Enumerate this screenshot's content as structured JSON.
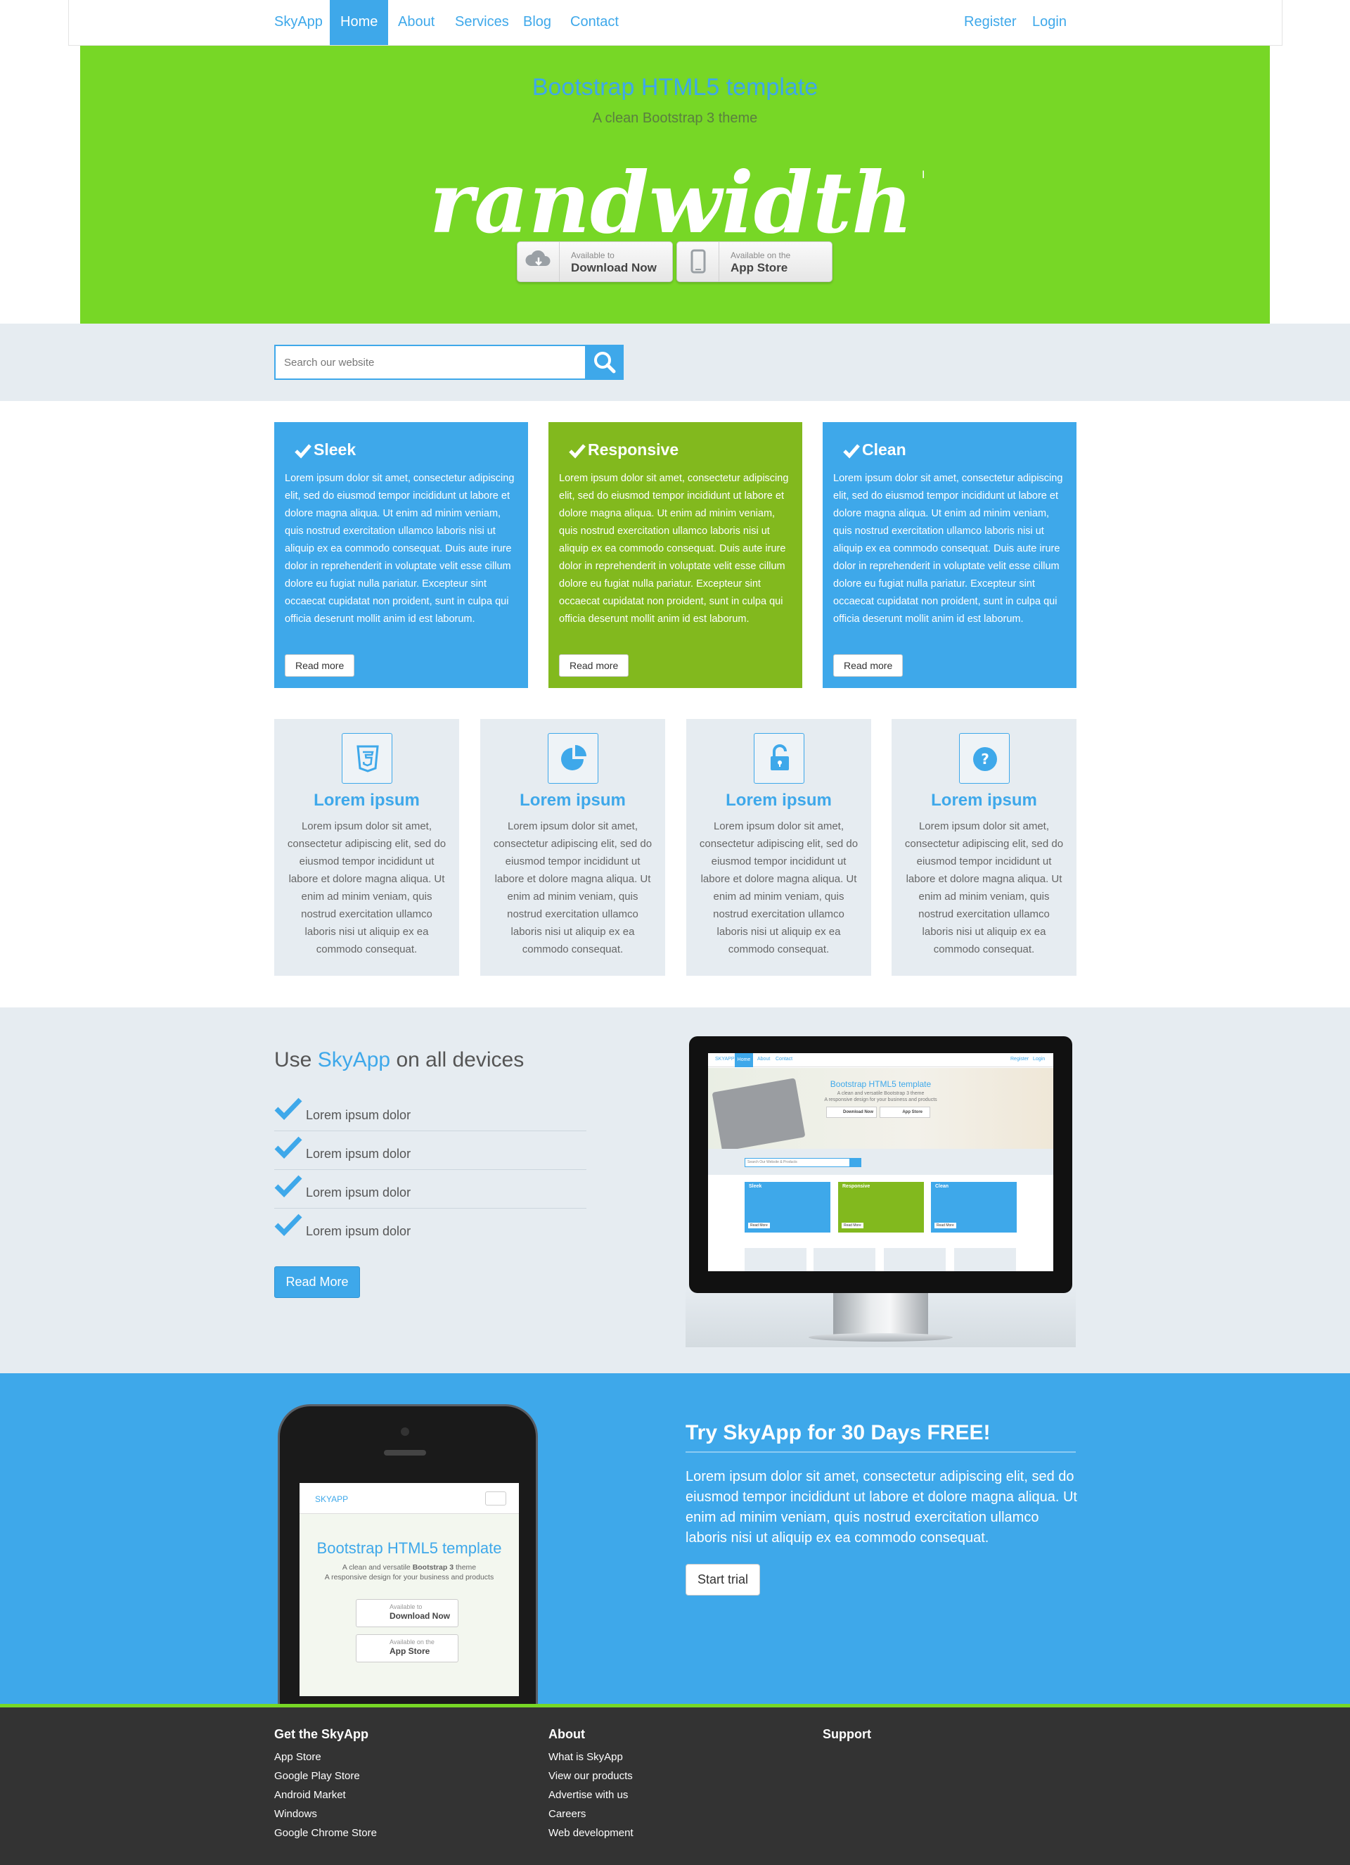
{
  "nav": {
    "brand": "SkyApp",
    "links": [
      "Home",
      "About",
      "Services",
      "Blog",
      "Contact"
    ],
    "active": "Home",
    "right": [
      "Register",
      "Login"
    ]
  },
  "hero": {
    "title": "Bootstrap HTML5 template",
    "subtitle": "A clean Bootstrap 3 theme",
    "logo_text": "Brandwidth™",
    "buttons": [
      {
        "small": "Available to",
        "big": "Download Now",
        "icon": "download-cloud-icon"
      },
      {
        "small": "Available on the",
        "big": "App Store",
        "icon": "phone-icon"
      }
    ]
  },
  "search": {
    "placeholder": "Search our website",
    "icon": "search-icon"
  },
  "features": [
    {
      "title": "Sleek",
      "color": "#3ea8ea",
      "text": "Lorem ipsum dolor sit amet, consectetur adipiscing elit, sed do eiusmod tempor incididunt ut labore et dolore magna aliqua. Ut enim ad minim veniam, quis nostrud exercitation ullamco laboris nisi ut aliquip ex ea commodo consequat. Duis aute irure dolor in reprehenderit in voluptate velit esse cillum dolore eu fugiat nulla pariatur. Excepteur sint occaecat cupidatat non proident, sunt in culpa qui officia deserunt mollit anim id est laborum.",
      "button": "Read more"
    },
    {
      "title": "Responsive",
      "color": "#82b91e",
      "text": "Lorem ipsum dolor sit amet, consectetur adipiscing elit, sed do eiusmod tempor incididunt ut labore et dolore magna aliqua. Ut enim ad minim veniam, quis nostrud exercitation ullamco laboris nisi ut aliquip ex ea commodo consequat. Duis aute irure dolor in reprehenderit in voluptate velit esse cillum dolore eu fugiat nulla pariatur. Excepteur sint occaecat cupidatat non proident, sunt in culpa qui officia deserunt mollit anim id est laborum.",
      "button": "Read more"
    },
    {
      "title": "Clean",
      "color": "#3ea8ea",
      "text": "Lorem ipsum dolor sit amet, consectetur adipiscing elit, sed do eiusmod tempor incididunt ut labore et dolore magna aliqua. Ut enim ad minim veniam, quis nostrud exercitation ullamco laboris nisi ut aliquip ex ea commodo consequat. Duis aute irure dolor in reprehenderit in voluptate velit esse cillum dolore eu fugiat nulla pariatur. Excepteur sint occaecat cupidatat non proident, sunt in culpa qui officia deserunt mollit anim id est laborum.",
      "button": "Read more"
    }
  ],
  "cards": [
    {
      "icon": "html5-icon",
      "title": "Lorem ipsum",
      "text": "Lorem ipsum dolor sit amet, consectetur adipiscing elit, sed do eiusmod tempor incididunt ut labore et dolore magna aliqua. Ut enim ad minim veniam, quis nostrud exercitation ullamco laboris nisi ut aliquip ex ea commodo consequat."
    },
    {
      "icon": "pie-chart-icon",
      "title": "Lorem ipsum",
      "text": "Lorem ipsum dolor sit amet, consectetur adipiscing elit, sed do eiusmod tempor incididunt ut labore et dolore magna aliqua. Ut enim ad minim veniam, quis nostrud exercitation ullamco laboris nisi ut aliquip ex ea commodo consequat."
    },
    {
      "icon": "unlock-icon",
      "title": "Lorem ipsum",
      "text": "Lorem ipsum dolor sit amet, consectetur adipiscing elit, sed do eiusmod tempor incididunt ut labore et dolore magna aliqua. Ut enim ad minim veniam, quis nostrud exercitation ullamco laboris nisi ut aliquip ex ea commodo consequat."
    },
    {
      "icon": "question-icon",
      "title": "Lorem ipsum",
      "text": "Lorem ipsum dolor sit amet, consectetur adipiscing elit, sed do eiusmod tempor incididunt ut labore et dolore magna aliqua. Ut enim ad minim veniam, quis nostrud exercitation ullamco laboris nisi ut aliquip ex ea commodo consequat."
    }
  ],
  "devices": {
    "title_pre": "Use",
    "title_accent": "SkyApp",
    "title_post": "on all devices",
    "items": [
      "Lorem ipsum dolor",
      "Lorem ipsum dolor",
      "Lorem ipsum dolor",
      "Lorem ipsum dolor"
    ],
    "button": "Read More"
  },
  "monitor_preview": {
    "nav_brand": "SKYAPP",
    "nav_links": [
      "Home",
      "About",
      "Contact"
    ],
    "nav_right": [
      "Register",
      "Login"
    ],
    "title": "Bootstrap HTML5 template",
    "line1": "A clean and versatile Bootstrap 3 theme",
    "line2": "A responsive design for your business and products",
    "btn1": "Download Now",
    "btn2": "App Store",
    "search_placeholder": "Search Our Website & Products",
    "boxes": [
      "Sleek",
      "Responsive",
      "Clean"
    ],
    "box_button": "Read More"
  },
  "trial": {
    "title": "Try SkyApp for 30 Days FREE!",
    "text": "Lorem ipsum dolor sit amet, consectetur adipiscing elit, sed do eiusmod tempor incididunt ut labore et dolore magna aliqua. Ut enim ad minim veniam, quis nostrud exercitation ullamco laboris nisi ut aliquip ex ea commodo consequat.",
    "button": "Start trial"
  },
  "phone_preview": {
    "brand": "SKYAPP",
    "title": "Bootstrap HTML5 template",
    "line1_pre": "A clean and versatile",
    "line1_bold": "Bootstrap 3",
    "line1_post": "theme",
    "line2": "A responsive design for your business and products",
    "btn1_small": "Available to",
    "btn1_big": "Download Now",
    "btn2_small": "Available on the",
    "btn2_big": "App Store"
  },
  "footer": {
    "columns": [
      {
        "heading": "Get the SkyApp",
        "links": [
          "App Store",
          "Google Play Store",
          "Android Market",
          "Windows",
          "Google Chrome Store"
        ]
      },
      {
        "heading": "About",
        "links": [
          "What is SkyApp",
          "View our products",
          "Advertise with us",
          "Careers",
          "Web development"
        ]
      },
      {
        "heading": "Support",
        "links": []
      }
    ]
  },
  "colors": {
    "accent": "#3ea8ea",
    "green": "#77d726",
    "dark_green": "#82b91e",
    "light_bg": "#e6ecf1",
    "footer": "#333333"
  }
}
